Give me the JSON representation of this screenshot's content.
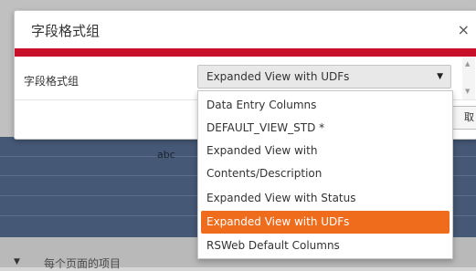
{
  "background": {
    "grid_cell_text": "abc",
    "bottom_text": "每个页面的项目"
  },
  "modal": {
    "title": "字段格式组",
    "close_label": "×",
    "accent_color": "#c9102b",
    "field_label": "字段格式组",
    "cancel_label": "取消"
  },
  "select": {
    "selected_value": "Expanded View with UDFs",
    "caret": "▼",
    "options": [
      {
        "label": "Data Entry Columns"
      },
      {
        "label": "DEFAULT_VIEW_STD *"
      },
      {
        "label_line1": "Expanded View with",
        "label_line2": "Contents/Description"
      },
      {
        "label": "Expanded View with Status"
      },
      {
        "label": "Expanded View with UDFs",
        "selected": true
      },
      {
        "label": "RSWeb Default Columns"
      }
    ],
    "highlight_color": "#ee6c1b"
  }
}
